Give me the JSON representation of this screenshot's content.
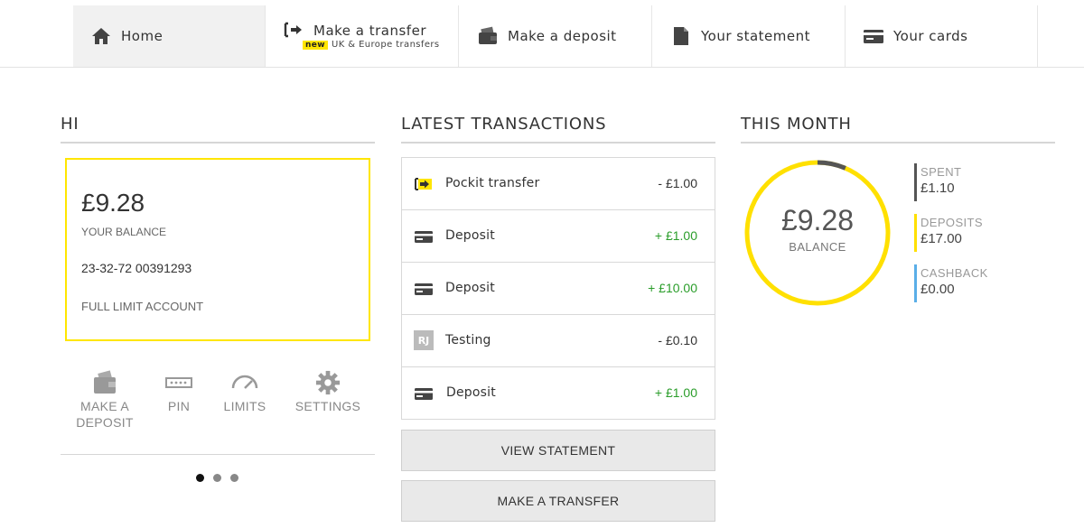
{
  "nav": {
    "home": "Home",
    "transfer": "Make a transfer",
    "transfer_badge": "new",
    "transfer_sub": "UK & Europe transfers",
    "deposit": "Make a deposit",
    "statement": "Your statement",
    "cards": "Your cards"
  },
  "account": {
    "heading": "HI",
    "balance": "£9.28",
    "balance_label": "YOUR BALANCE",
    "account_number": "23-32-72 00391293",
    "account_type": "FULL LIMIT ACCOUNT",
    "actions": [
      {
        "label_line1": "MAKE A",
        "label_line2": "DEPOSIT",
        "icon": "wallet-icon"
      },
      {
        "label": "PIN",
        "icon": "pin-pad-icon"
      },
      {
        "label": "LIMITS",
        "icon": "gauge-icon"
      },
      {
        "label": "SETTINGS",
        "icon": "gear-icon"
      }
    ],
    "carousel_pages": 3,
    "carousel_active": 1
  },
  "transactions": {
    "heading": "LATEST TRANSACTIONS",
    "items": [
      {
        "name": "Pockit transfer",
        "amount": "- £1.00",
        "type": "transfer",
        "icon": "transfer-icon"
      },
      {
        "name": "Deposit",
        "amount": "+ £1.00",
        "type": "deposit",
        "icon": "card-icon"
      },
      {
        "name": "Deposit",
        "amount": "+ £10.00",
        "type": "deposit",
        "icon": "card-icon"
      },
      {
        "name": "Testing",
        "amount": "- £0.10",
        "type": "payment",
        "initials": "RJ"
      },
      {
        "name": "Deposit",
        "amount": "+ £1.00",
        "type": "deposit",
        "icon": "card-icon"
      }
    ],
    "view_statement": "VIEW STATEMENT",
    "make_transfer": "MAKE A TRANSFER"
  },
  "month": {
    "heading": "THIS MONTH",
    "balance": "£9.28",
    "balance_label": "BALANCE",
    "spent_label": "SPENT",
    "spent": "£1.10",
    "deposits_label": "DEPOSITS",
    "deposits": "£17.00",
    "cashback_label": "CASHBACK",
    "cashback": "£0.00",
    "spent_fraction": 0.0647,
    "colors": {
      "accent": "#ffe000",
      "spent": "#555555",
      "cashback": "#5aaee8"
    }
  }
}
